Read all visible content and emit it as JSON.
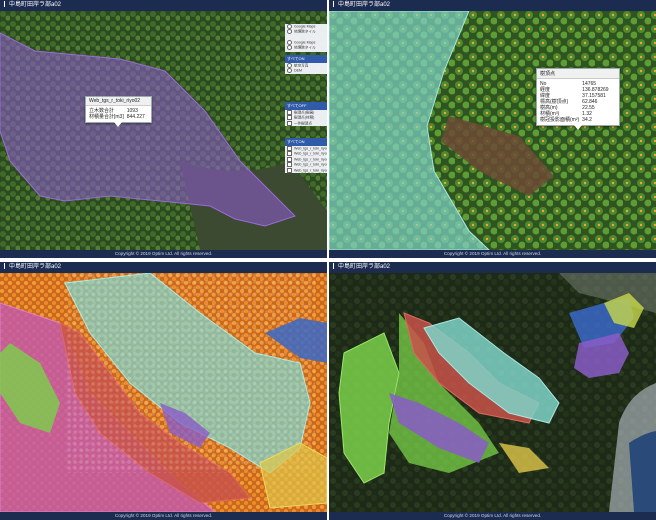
{
  "panels": [
    {
      "title": "中島町田岸ラ部a02",
      "footer": "Copyright © 2019 Optim Ltd.  All rights reserved."
    },
    {
      "title": "中島町田岸ラ部a02",
      "footer": "Copyright © 2019 Optim Ltd.  All rights reserved."
    },
    {
      "title": "中島町田岸ラ部a02",
      "footer": "Copyright © 2019 Optim Ltd.  All rights reserved."
    },
    {
      "title": "中島町田岸ラ部a02",
      "footer": "Copyright © 2019 Optim Ltd.  All rights reserved."
    }
  ],
  "popup1": {
    "title": "Web_tgs_r_toki_riyo02",
    "rows": [
      {
        "label": "立木数合計",
        "value": "1093"
      },
      {
        "label": "材積量合計[m3]",
        "value": "844.227"
      }
    ]
  },
  "popup2": {
    "title": "樹頂点",
    "rows": [
      {
        "label": "No",
        "value": "14765"
      },
      {
        "label": "経度",
        "value": "136.878269"
      },
      {
        "label": "緯度",
        "value": "37.157581"
      },
      {
        "label": "標高(樹頂点)",
        "value": "62.846"
      },
      {
        "label": "樹高(m)",
        "value": "22.55"
      },
      {
        "label": "材積(m³)",
        "value": "1.32"
      },
      {
        "label": "樹冠投影面積(m²)",
        "value": "34.2"
      }
    ]
  },
  "legend": {
    "group1_header": "すべてON",
    "group1_items": [
      "Google Maps",
      "地理院タイル",
      "Google Maps",
      "地理院タイル",
      "Google Maps地形"
    ],
    "group2_header": "すべてON",
    "group2_items": [
      "航空写真",
      "DEM"
    ],
    "group3_header": "すべてOFF",
    "group3_items": [
      "樹頂点(樹高)",
      "樹頂点(材積)",
      "一件樹頂点"
    ],
    "group4_header": "すべてON",
    "group4_items": [
      "Web_tgs_r_toki_riyo01",
      "Web_tgs_r_toki_riyo02",
      "Web_tgs_r_toki_riyo03",
      "Web_tgs_r_toki_riyo04",
      "Web_tgs_r_toki_riyo05"
    ]
  },
  "colors": {
    "header": "#1c2b50",
    "purple_zone": "#8a5cc8",
    "teal_zone": "#7fd3c8",
    "orange_trees": "#f08a2a",
    "magenta_zone": "#c45aa8",
    "red_zone": "#c8524a",
    "green_zone": "#7ad14a",
    "blue_zone": "#3a68c8",
    "yellow_zone": "#e0c84a"
  }
}
